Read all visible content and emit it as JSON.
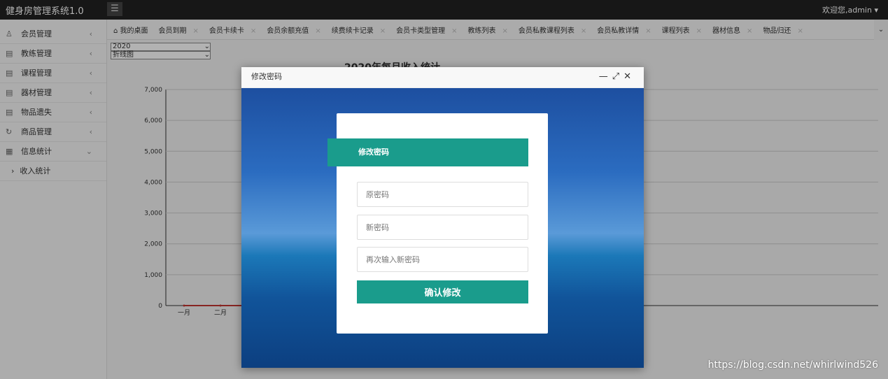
{
  "app": {
    "title": "健身房管理系统1.0",
    "user": "欢迎您,admin"
  },
  "sidebar": {
    "items": [
      {
        "label": "会员管理",
        "icon": "user-icon"
      },
      {
        "label": "教练管理",
        "icon": "doc-icon"
      },
      {
        "label": "课程管理",
        "icon": "doc-icon"
      },
      {
        "label": "器材管理",
        "icon": "doc-icon"
      },
      {
        "label": "物品遗失",
        "icon": "doc-icon"
      },
      {
        "label": "商品管理",
        "icon": "cycle-icon"
      },
      {
        "label": "信息统计",
        "icon": "grid-icon"
      }
    ],
    "sub": "收入统计"
  },
  "tabs": [
    "我的桌面",
    "会员到期",
    "会员卡续卡",
    "会员余额充值",
    "续费续卡记录",
    "会员卡类型管理",
    "教练列表",
    "会员私教课程列表",
    "会员私教详情",
    "课程列表",
    "器材信息",
    "物品归还"
  ],
  "filters": {
    "year": "2020",
    "chart_type": "折线图"
  },
  "chart_data": {
    "type": "line",
    "title": "2020年每月收入统计",
    "categories": [
      "一月",
      "二月"
    ],
    "values": [
      0,
      0
    ],
    "ylim": [
      0,
      7000
    ],
    "yticks": [
      "0",
      "1,000",
      "2,000",
      "3,000",
      "4,000",
      "5,000",
      "6,000",
      "7,000"
    ],
    "line_color": "#c23531"
  },
  "dialog": {
    "title": "修改密码",
    "header": "修改密码",
    "old_placeholder": "原密码",
    "new_placeholder": "新密码",
    "confirm_placeholder": "再次输入新密码",
    "submit": "确认修改",
    "accent": "#1a9c8c"
  },
  "watermark": "https://blog.csdn.net/whirlwind526"
}
